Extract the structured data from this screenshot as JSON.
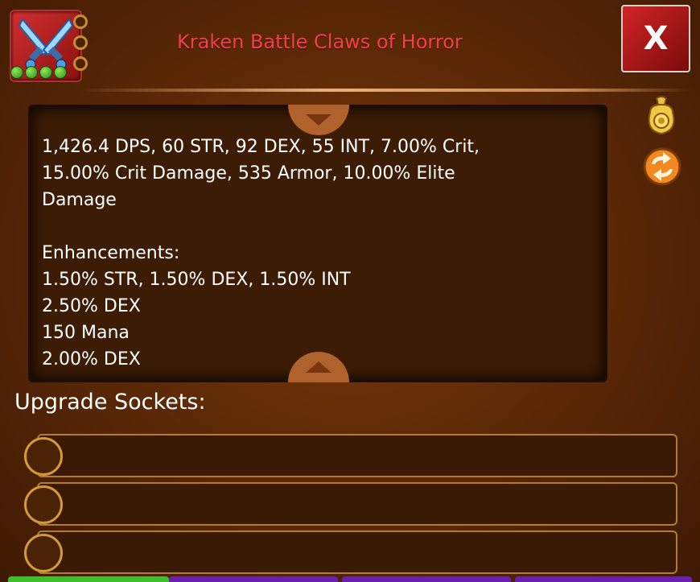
{
  "item": {
    "title": "Kraken Battle Claws of Horror",
    "icon": "crossed-claws-icon",
    "gems_filled": 4,
    "side_sockets": 3
  },
  "close_button": {
    "label": "X"
  },
  "stats": {
    "lines": [
      "1,426.4 DPS, 60 STR, 92 DEX, 55 INT, 7.00% Crit,",
      "15.00% Crit Damage, 535 Armor, 10.00% Elite",
      "Damage",
      "",
      "Enhancements:",
      "1.50% STR, 1.50% DEX, 1.50% INT",
      "2.50% DEX",
      "150 Mana",
      "2.00% DEX"
    ]
  },
  "side_actions": [
    {
      "name": "sell-bag-icon"
    },
    {
      "name": "swap-icon"
    }
  ],
  "upgrade_sockets": {
    "label": "Upgrade Sockets:",
    "rows": 3
  },
  "colors": {
    "title": "#f0414b",
    "background": "#5e2a07",
    "close_button": "#c21c1c",
    "gem": "#3fb52a",
    "bottom_tabs": [
      "#3cbf2a",
      "#6a1fae",
      "#6a1fae",
      "#6a1fae"
    ]
  }
}
